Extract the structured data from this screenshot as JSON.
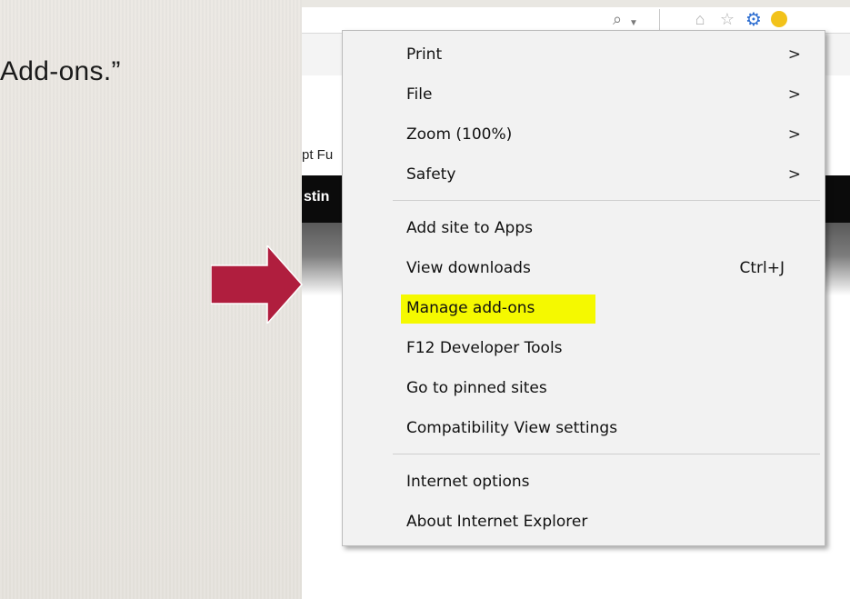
{
  "slide": {
    "caption": "Add-ons.”"
  },
  "browser": {
    "favorites_fragment": "pt Fu",
    "dark_bar_fragment": "stin"
  },
  "menu": {
    "items": [
      {
        "label": "Print",
        "has_submenu": true
      },
      {
        "label": "File",
        "has_submenu": true
      },
      {
        "label": "Zoom (100%)",
        "has_submenu": true
      },
      {
        "label": "Safety",
        "has_submenu": true
      },
      {
        "label": "Add site to Apps"
      },
      {
        "label": "View downloads",
        "shortcut": "Ctrl+J"
      },
      {
        "label": "Manage add-ons",
        "highlighted": true
      },
      {
        "label": "F12 Developer Tools"
      },
      {
        "label": "Go to pinned sites"
      },
      {
        "label": "Compatibility View settings"
      },
      {
        "label": "Internet options"
      },
      {
        "label": "About Internet Explorer"
      }
    ],
    "submenu_glyph": ">",
    "highlight_color": "#f5f900"
  },
  "colors": {
    "arrow": "#b01e3e",
    "gear": "#2f6fd1"
  },
  "icons": [
    "search-icon",
    "dropdown-icon",
    "home-icon",
    "favorites-star-icon",
    "tools-gear-icon",
    "feedback-smiley-icon",
    "chevron-right-icon"
  ]
}
